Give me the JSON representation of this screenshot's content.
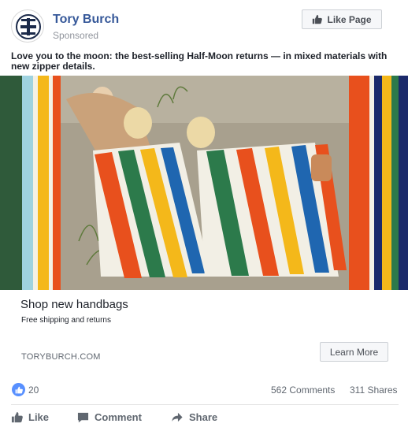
{
  "post": {
    "brand_name": "Tory Burch",
    "sponsored_label": "Sponsored",
    "like_page_label": "Like Page",
    "caption": "Love you to the moon: the best-selling Half-Moon returns — in mixed materials with new zipper details."
  },
  "link_card": {
    "title": "Shop new handbags",
    "description": "Free shipping and returns",
    "domain": "TORYBURCH.COM",
    "cta_label": "Learn More"
  },
  "stats": {
    "likes": "20",
    "comments": "562 Comments",
    "shares": "311 Shares"
  },
  "actions": {
    "like_label": "Like",
    "comment_label": "Comment",
    "share_label": "Share"
  },
  "colors": {
    "brand_blue": "#365899",
    "like_blue": "#5890ff"
  },
  "icons": [
    "tory-burch-logo",
    "thumbs-up-icon",
    "comment-icon",
    "share-icon"
  ]
}
